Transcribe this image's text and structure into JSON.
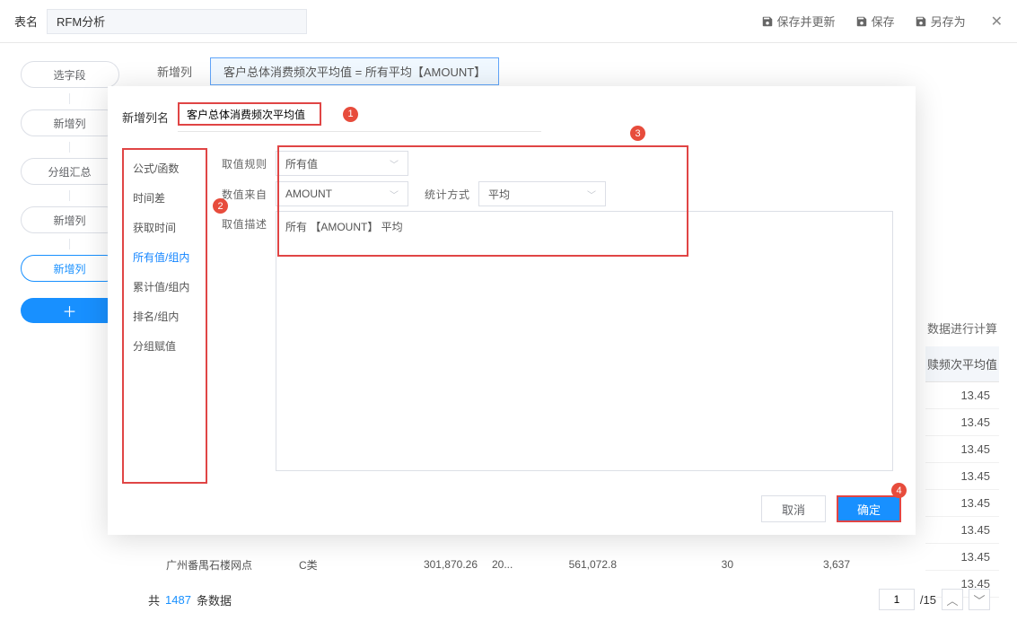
{
  "header": {
    "table_name_label": "表名",
    "table_name_value": "RFM分析",
    "save_update": "保存并更新",
    "save": "保存",
    "save_as": "另存为"
  },
  "sidebar": {
    "items": [
      {
        "label": "选字段"
      },
      {
        "label": "新增列"
      },
      {
        "label": "分组汇总"
      },
      {
        "label": "新增列"
      },
      {
        "label": "新增列"
      }
    ]
  },
  "main": {
    "add_col_label": "新增列",
    "formula_text": "客户总体消费频次平均值 = 所有平均【AMOUNT】",
    "right_label": "数据进行计算",
    "column_header": "赎频次平均值",
    "column_values": [
      "13.45",
      "13.45",
      "13.45",
      "13.45",
      "13.45",
      "13.45",
      "13.45",
      "13.45"
    ]
  },
  "bg_row": {
    "name": "广州番禺石楼网点",
    "cls": "C类",
    "v1": "301,870.26",
    "v2": "20...",
    "v3": "561,072.8",
    "v4": "30",
    "v5": "3,637"
  },
  "footer": {
    "prefix": "共",
    "count": "1487",
    "suffix": "条数据",
    "page": "1",
    "total_pages": "/15"
  },
  "modal": {
    "name_label": "新增列名",
    "name_value": "客户总体消费频次平均值",
    "func_items": [
      {
        "label": "公式/函数"
      },
      {
        "label": "时间差"
      },
      {
        "label": "获取时间"
      },
      {
        "label": "所有值/组内"
      },
      {
        "label": "累计值/组内"
      },
      {
        "label": "排名/组内"
      },
      {
        "label": "分组赋值"
      }
    ],
    "rule_label": "取值规则",
    "rule_value": "所有值",
    "source_label": "数值来自",
    "source_value": "AMOUNT",
    "stat_label": "统计方式",
    "stat_value": "平均",
    "desc_label": "取值描述",
    "desc_text": "所有 【AMOUNT】 平均",
    "cancel": "取消",
    "ok": "确定"
  },
  "callouts": {
    "c1": "1",
    "c2": "2",
    "c3": "3",
    "c4": "4"
  }
}
